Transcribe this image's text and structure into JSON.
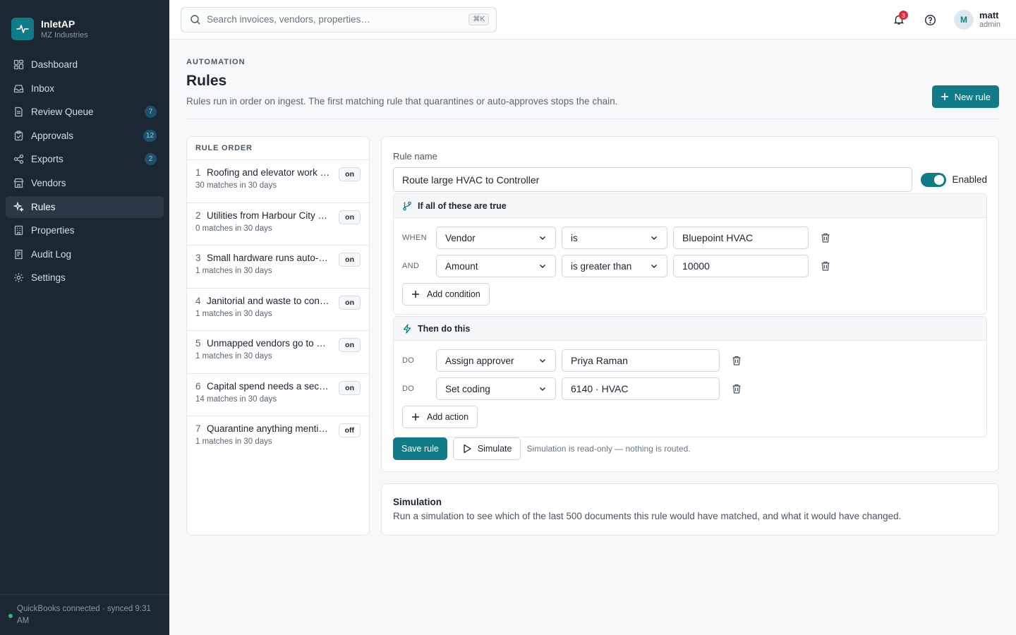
{
  "brand": {
    "name": "InletAP",
    "org": "MZ Industries"
  },
  "nav": [
    {
      "label": "Dashboard",
      "icon": "dashboard-icon",
      "badge": ""
    },
    {
      "label": "Inbox",
      "icon": "inbox-icon",
      "badge": ""
    },
    {
      "label": "Review Queue",
      "icon": "review-queue-icon",
      "badge": "7"
    },
    {
      "label": "Approvals",
      "icon": "approvals-icon",
      "badge": "12"
    },
    {
      "label": "Exports",
      "icon": "exports-icon",
      "badge": "2"
    },
    {
      "label": "Vendors",
      "icon": "vendors-icon",
      "badge": ""
    },
    {
      "label": "Rules",
      "icon": "rules-icon",
      "badge": ""
    },
    {
      "label": "Properties",
      "icon": "properties-icon",
      "badge": ""
    },
    {
      "label": "Audit Log",
      "icon": "audit-log-icon",
      "badge": ""
    },
    {
      "label": "Settings",
      "icon": "settings-icon",
      "badge": ""
    }
  ],
  "active_nav": "Rules",
  "sync_status": "QuickBooks connected · synced 9:31 AM",
  "search": {
    "placeholder": "Search invoices, vendors, properties…",
    "shortcut": "⌘K"
  },
  "notifications": {
    "count": "3"
  },
  "user": {
    "initial": "M",
    "name": "matt",
    "role": "admin"
  },
  "page": {
    "eyebrow": "AUTOMATION",
    "title": "Rules",
    "description": "Rules run in order on ingest. The first matching rule that quarantines or auto-approves stops the chain.",
    "new_rule_label": "New rule"
  },
  "rule_list": {
    "header": "RULE ORDER",
    "rules": [
      {
        "num": "1",
        "title": "Roofing and elevator work to PM",
        "status": "on",
        "matches": "30 matches in 30 days"
      },
      {
        "num": "2",
        "title": "Utilities from Harbour City Power",
        "status": "on",
        "matches": "0 matches in 30 days"
      },
      {
        "num": "3",
        "title": "Small hardware runs auto-approve",
        "status": "on",
        "matches": "1 matches in 30 days"
      },
      {
        "num": "4",
        "title": "Janitorial and waste to controller",
        "status": "on",
        "matches": "1 matches in 30 days"
      },
      {
        "num": "5",
        "title": "Unmapped vendors go to Priya",
        "status": "on",
        "matches": "1 matches in 30 days"
      },
      {
        "num": "6",
        "title": "Capital spend needs a second approver",
        "status": "on",
        "matches": "14 matches in 30 days"
      },
      {
        "num": "7",
        "title": "Quarantine anything mentioning wire",
        "status": "off",
        "matches": "1 matches in 30 days"
      }
    ]
  },
  "editor": {
    "name_label": "Rule name",
    "name_value": "Route large HVAC to Controller",
    "enabled": true,
    "enabled_label": "Enabled",
    "conditions_header": "If all of these are true",
    "conditions": [
      {
        "tag": "WHEN",
        "field": "Vendor",
        "operator": "is",
        "value": "Bluepoint HVAC"
      },
      {
        "tag": "AND",
        "field": "Amount",
        "operator": "is greater than",
        "value": "10000"
      }
    ],
    "add_condition_label": "Add condition",
    "actions_header": "Then do this",
    "actions": [
      {
        "tag": "DO",
        "action": "Assign approver",
        "value": "Priya Raman"
      },
      {
        "tag": "DO",
        "action": "Set coding",
        "value": "6140 · HVAC"
      }
    ],
    "add_action_label": "Add action",
    "save_label": "Save rule",
    "simulate_label": "Simulate",
    "simulate_note": "Simulation is read-only — nothing is routed."
  },
  "simulation": {
    "title": "Simulation",
    "description": "Run a simulation to see which of the last 500 documents this rule would have matched, and what it would have changed."
  },
  "colors": {
    "accent": "#127b88",
    "sidebar_bg": "#1b2834",
    "badge_red": "#d72c3a",
    "sync_green": "#2eb87a"
  }
}
